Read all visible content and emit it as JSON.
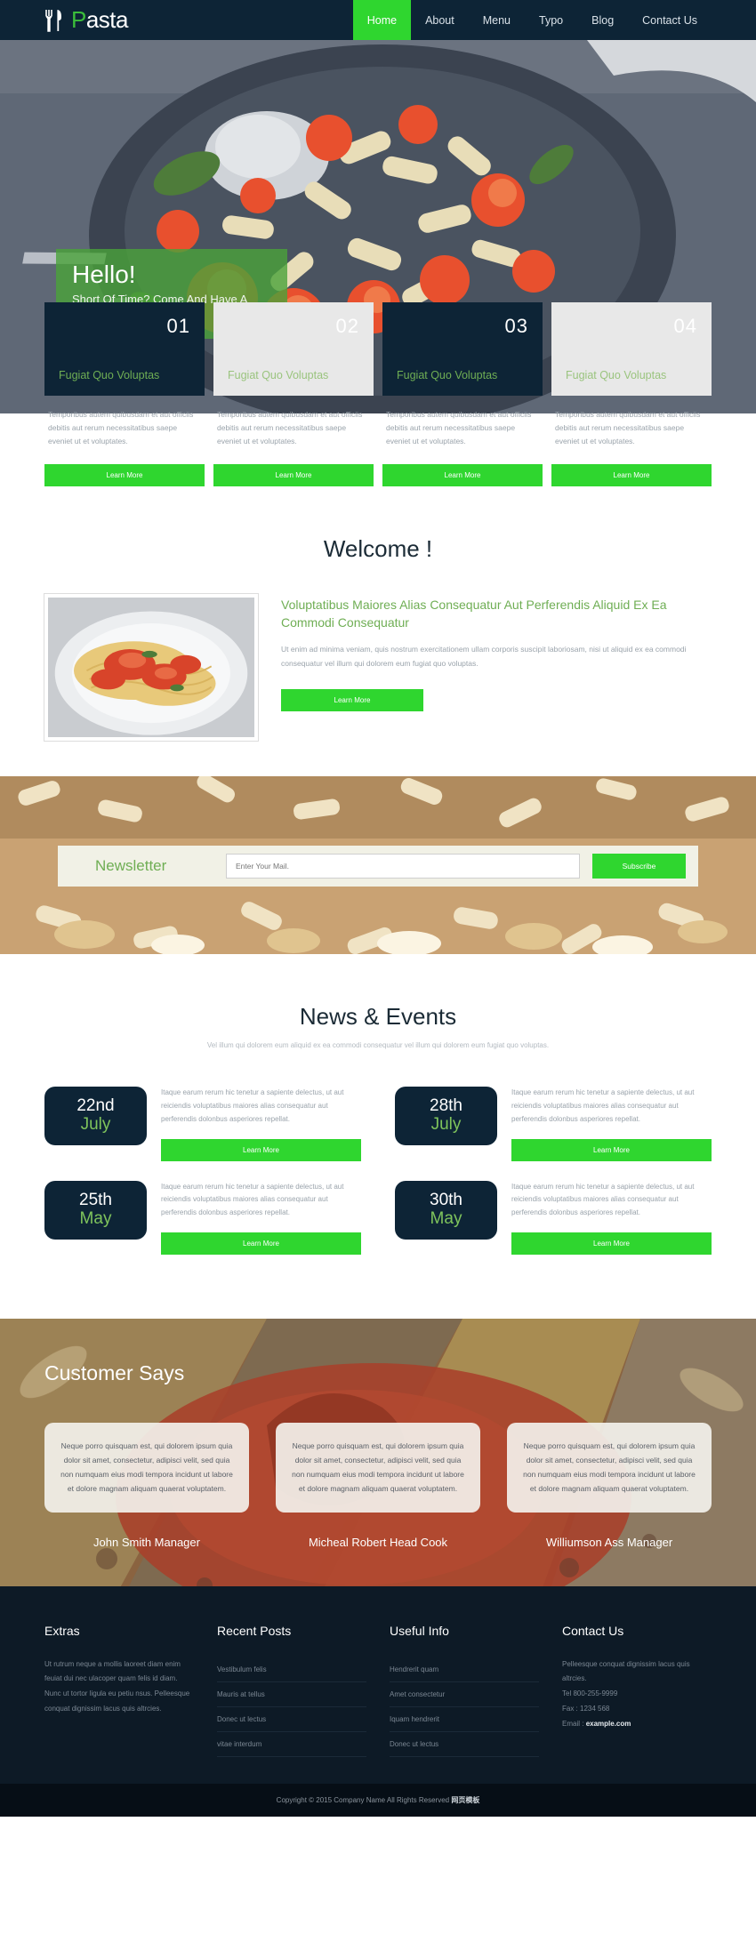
{
  "header": {
    "logo_p": "P",
    "logo_rest": "asta",
    "nav": [
      {
        "label": "Home",
        "active": true
      },
      {
        "label": "About",
        "active": false
      },
      {
        "label": "Menu",
        "active": false
      },
      {
        "label": "Typo",
        "active": false
      },
      {
        "label": "Blog",
        "active": false
      },
      {
        "label": "Contact Us",
        "active": false
      }
    ]
  },
  "hero": {
    "heading": "Hello!",
    "subtext": "Short Of Time? Come And Have A Tasty Pasta!"
  },
  "services": {
    "description": "Temporibus autem quibusdam et aut officiis debitis aut rerum necessitatibus saepe eveniet ut et voluptates.",
    "button_label": "Learn More",
    "items": [
      {
        "number": "01",
        "title": "Fugiat Quo Voluptas",
        "theme": "dark"
      },
      {
        "number": "02",
        "title": "Fugiat Quo Voluptas",
        "theme": "light"
      },
      {
        "number": "03",
        "title": "Fugiat Quo Voluptas",
        "theme": "dark"
      },
      {
        "number": "04",
        "title": "Fugiat Quo Voluptas",
        "theme": "light"
      }
    ]
  },
  "welcome": {
    "title": "Welcome !",
    "subtitle": "Voluptatibus Maiores Alias Consequatur Aut Perferendis Aliquid Ex Ea Commodi Consequatur",
    "body": "Ut enim ad minima veniam, quis nostrum exercitationem ullam corporis suscipit laboriosam, nisi ut aliquid ex ea commodi consequatur vel illum qui dolorem eum fugiat quo voluptas.",
    "button_label": "Learn More"
  },
  "newsletter": {
    "title": "Newsletter",
    "placeholder": "Enter Your Mail.",
    "button_label": "Subscribe"
  },
  "news": {
    "title": "News & Events",
    "subtitle": "Vel illum qui dolorem eum aliquid ex ea commodi consequatur vel illum qui dolorem eum fugiat quo voluptas.",
    "button_label": "Learn More",
    "body_text": "Itaque earum rerum hic tenetur a sapiente delectus, ut aut reiciendis voluptatibus maiores alias consequatur aut perferendis dolonbus asperiores repellat.",
    "items": [
      {
        "day": "22nd",
        "month": "July"
      },
      {
        "day": "28th",
        "month": "July"
      },
      {
        "day": "25th",
        "month": "May"
      },
      {
        "day": "30th",
        "month": "May"
      }
    ]
  },
  "testimonials": {
    "title": "Customer Says",
    "quote": "Neque porro quisquam est, qui dolorem ipsum quia dolor sit amet, consectetur, adipisci velit, sed quia non numquam eius modi tempora incidunt ut labore et dolore magnam aliquam quaerat voluptatem.",
    "names": [
      "John Smith Manager",
      "Micheal Robert Head Cook",
      "Williumson Ass Manager"
    ]
  },
  "footer": {
    "extras": {
      "title": "Extras",
      "text": "Ut rutrum neque a mollis laoreet diam enim feuiat dui nec ulacoper quam felis id diam. Nunc ut tortor ligula eu petiu nsus. Pelleesque conquat dignissim lacus quis altrcies."
    },
    "recent_posts": {
      "title": "Recent Posts",
      "links": [
        "Vestibulum felis",
        "Mauris at tellus",
        "Donec ut lectus",
        "vitae interdum"
      ]
    },
    "useful_info": {
      "title": "Useful Info",
      "links": [
        "Hendrerit quam",
        "Amet consectetur",
        "Iquam hendrerit",
        "Donec ut lectus"
      ]
    },
    "contact": {
      "title": "Contact Us",
      "address": "Pelleesque conquat dignissim lacus quis altrcies.",
      "tel": "Tel 800-255-9999",
      "fax": "Fax : 1234 568",
      "email_label": "Email :",
      "email_value": "example.com"
    }
  },
  "copyright": {
    "text": "Copyright © 2015 Company Name All Rights Reserved ",
    "cn": "网页模板"
  },
  "colors": {
    "navy": "#0d2436",
    "green": "#2fd62f",
    "accent_green": "#6fae54"
  }
}
